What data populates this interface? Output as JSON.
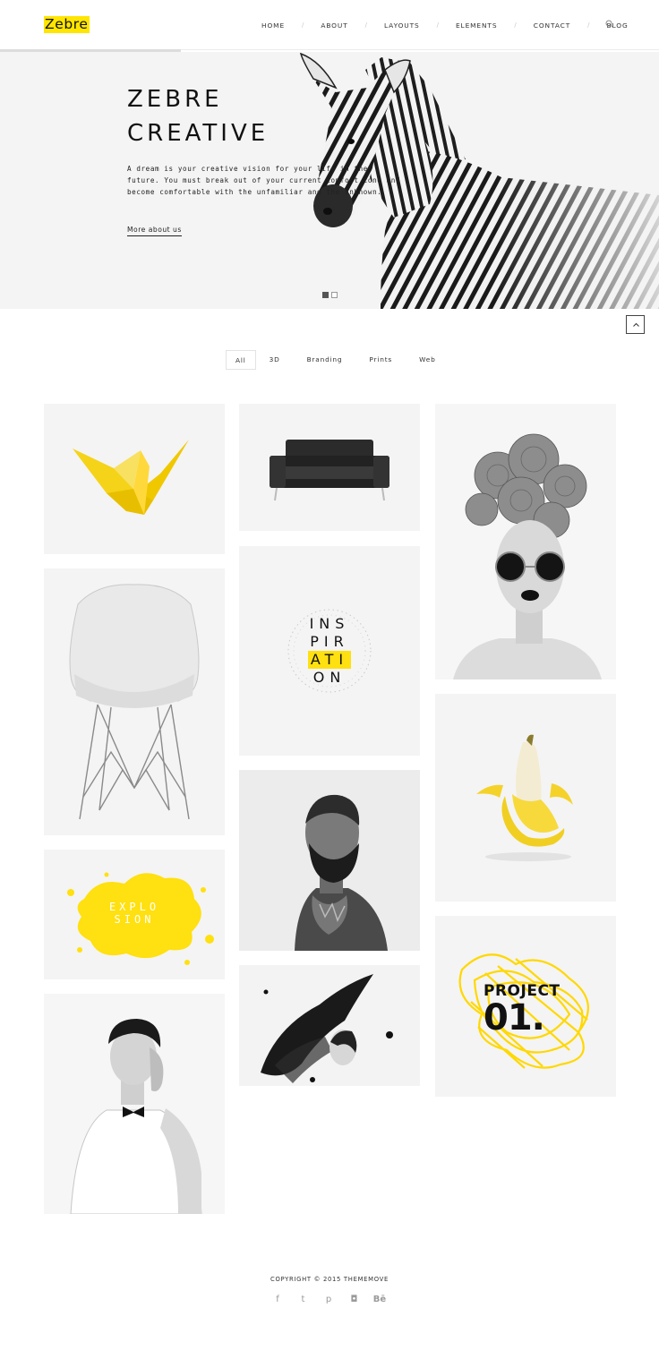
{
  "brand": {
    "logo": "Zebre",
    "accent": "#ffe500"
  },
  "nav": {
    "items": [
      "HOME",
      "ABOUT",
      "LAYOUTS",
      "ELEMENTS",
      "CONTACT",
      "BLOG"
    ],
    "separator": "/",
    "search_icon": "search-icon"
  },
  "hero": {
    "title_line1": "ZEBRE",
    "title_line2": "CREATIVE",
    "description": "A dream is your creative vision for your life in the future. You must break out of your current comfort zone and become comfortable with the unfamiliar and the unknown.",
    "link": "More about us",
    "slides": 2,
    "active_slide": 1
  },
  "scroll_top_icon": "chevron-up-icon",
  "filters": [
    "All",
    "3D",
    "Branding",
    "Prints",
    "Web"
  ],
  "active_filter": "All",
  "portfolio": {
    "items": [
      {
        "name": "origami-crane",
        "image": "yellow origami bird"
      },
      {
        "name": "black-sofa",
        "image": "black sofa"
      },
      {
        "name": "flower-head-woman",
        "image": "woman with flower headdress and round sunglasses"
      },
      {
        "name": "white-chair",
        "image": "white chair with wire legs"
      },
      {
        "name": "inspiration-typography",
        "lines": [
          "INS",
          "PIR",
          "ATI",
          "ON"
        ]
      },
      {
        "name": "banana",
        "image": "peeled banana"
      },
      {
        "name": "explosion-splash",
        "lines": [
          "EXPLO",
          "SION"
        ]
      },
      {
        "name": "bearded-man",
        "image": "double exposure bearded man"
      },
      {
        "name": "project-01",
        "lines": [
          "PROJECT",
          "01."
        ]
      },
      {
        "name": "man-portrait",
        "image": "man in white shirt and bow tie"
      },
      {
        "name": "feather-hat-woman",
        "image": "woman with black feather hat"
      }
    ]
  },
  "footer": {
    "copyright": "COPYRIGHT © 2015 THEMEMOVE",
    "socials": [
      {
        "icon": "facebook-icon",
        "glyph": "f"
      },
      {
        "icon": "twitter-icon",
        "glyph": "t"
      },
      {
        "icon": "pinterest-icon",
        "glyph": "p"
      },
      {
        "icon": "instagram-icon",
        "glyph": "◘"
      },
      {
        "icon": "behance-icon",
        "glyph": "Bē"
      }
    ]
  }
}
